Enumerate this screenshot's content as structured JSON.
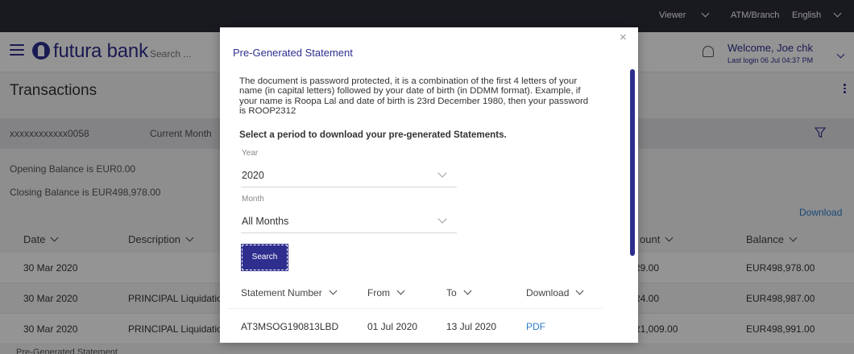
{
  "topbar": {
    "viewer": "Viewer",
    "branch": "ATM/Branch",
    "language": "English"
  },
  "header": {
    "logo": "futura bank",
    "search_placeholder": "Search ...",
    "welcome": "Welcome, Joe chk",
    "last_login": "Last login 06 Jul 04:37 PM"
  },
  "page": {
    "title": "Transactions",
    "account": "xxxxxxxxxxxx0058",
    "period": "Current Month",
    "opening_balance": "Opening Balance is EUR0.00",
    "closing_balance": "Closing Balance is EUR498,978.00",
    "download": "Download",
    "columns": {
      "date": "Date",
      "description": "Description",
      "amount": "ount",
      "balance": "Balance"
    },
    "rows": [
      {
        "date": "30 Mar 2020",
        "description": "",
        "amount": "R9.00",
        "balance": "EUR498,978.00"
      },
      {
        "date": "30 Mar 2020",
        "description": "PRINCIPAL Liquidatio",
        "amount": "R4.00",
        "balance": "EUR498,987.00"
      },
      {
        "date": "30 Mar 2020",
        "description": "PRINCIPAL Liquidatio",
        "amount": "R1,009.00",
        "balance": "EUR498,991.00"
      }
    ],
    "pregenerated_link": "Pre-Generated Statement"
  },
  "modal": {
    "title": "Pre-Generated Statement",
    "close": "×",
    "info": "The document is password protected, it is a combination of the first 4 letters of your name (in capital letters) followed by your date of birth (in DDMM format). Example, if your name is Roopa Lal and date of birth is 23rd December 1980, then your password is ROOP2312",
    "subtitle": "Select a period to download your pre-generated Statements.",
    "year_label": "Year",
    "year_value": "2020",
    "month_label": "Month",
    "month_value": "All Months",
    "search_button": "Search",
    "columns": {
      "statement_number": "Statement Number",
      "from": "From",
      "to": "To",
      "download": "Download"
    },
    "statements": [
      {
        "number": "AT3MSOG190813LBD",
        "from": "01 Jul 2020",
        "to": "13 Jul 2020",
        "download": "PDF"
      }
    ]
  },
  "colors": {
    "brand": "#2e2e8f",
    "link": "#2a7ccc",
    "topbar": "#2b2b37"
  }
}
